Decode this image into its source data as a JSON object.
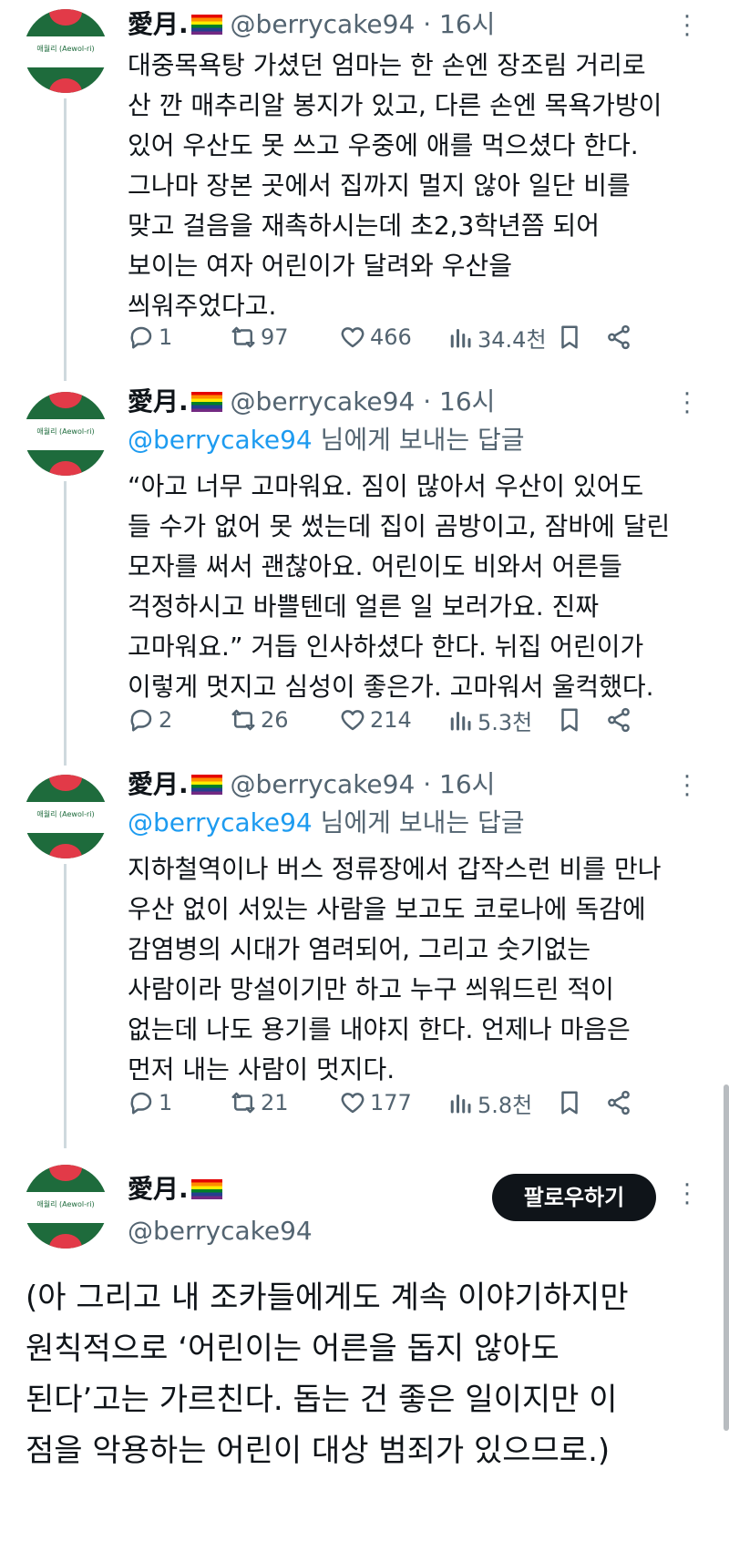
{
  "colors": {
    "text": "#0f1419",
    "muted": "#536471",
    "link": "#1d9bf0",
    "avatar_green": "#1e6b3c",
    "avatar_red": "#e23a48"
  },
  "avatar_logo": "애월리 (Aewol-ri)",
  "tweets": [
    {
      "name": "愛月.",
      "handle": "@berrycake94",
      "sep": "·",
      "time": "16시",
      "reply_to": null,
      "text": "대중목욕탕 가셨던 엄마는 한 손엔 장조림 거리로\n산 깐 매추리알 봉지가 있고, 다른 손엔 목욕가방이\n있어 우산도 못 쓰고 우중에 애를 먹으셨다 한다.\n그나마 장본 곳에서 집까지 멀지 않아 일단 비를\n맞고 걸음을 재촉하시는데 초2,3학년쯤 되어\n보이는 여자 어린이가 달려와 우산을\n씌워주었다고.",
      "stats": {
        "replies": "1",
        "retweets": "97",
        "likes": "466",
        "views": "34.4천"
      }
    },
    {
      "name": "愛月.",
      "handle": "@berrycake94",
      "sep": "·",
      "time": "16시",
      "reply_to": {
        "mention": "@berrycake94",
        "suffix": " 님에게 보내는 답글"
      },
      "text": "“아고 너무 고마워요. 짐이 많아서 우산이 있어도\n들 수가 없어 못 썼는데 집이 곰방이고, 잠바에 달린\n모자를 써서 괜찮아요. 어린이도 비와서 어른들\n걱정하시고 바쁠텐데 얼른 일 보러가요. 진짜\n고마워요.” 거듭 인사하셨다 한다. 뉘집 어린이가\n이렇게 멋지고 심성이 좋은가. 고마워서 울컥했다.",
      "stats": {
        "replies": "2",
        "retweets": "26",
        "likes": "214",
        "views": "5.3천"
      }
    },
    {
      "name": "愛月.",
      "handle": "@berrycake94",
      "sep": "·",
      "time": "16시",
      "reply_to": {
        "mention": "@berrycake94",
        "suffix": " 님에게 보내는 답글"
      },
      "text": "지하철역이나 버스 정류장에서 갑작스런 비를 만나\n우산 없이 서있는 사람을 보고도 코로나에 독감에\n감염병의 시대가 염려되어, 그리고 숫기없는\n사람이라 망설이기만 하고 누구 씌워드린 적이\n없는데 나도 용기를 내야지 한다. 언제나 마음은\n먼저 내는 사람이 멋지다.",
      "stats": {
        "replies": "1",
        "retweets": "21",
        "likes": "177",
        "views": "5.8천"
      }
    }
  ],
  "main_tweet": {
    "name": "愛月.",
    "handle": "@berrycake94",
    "follow_label": "팔로우하기",
    "text": "(아 그리고 내 조카들에게도 계속 이야기하지만\n원칙적으로 ‘어린이는 어른을 돕지 않아도\n된다’고는 가르친다. 돕는 건 좋은 일이지만 이\n점을 악용하는 어린이 대상 범죄가 있으므로.)"
  }
}
